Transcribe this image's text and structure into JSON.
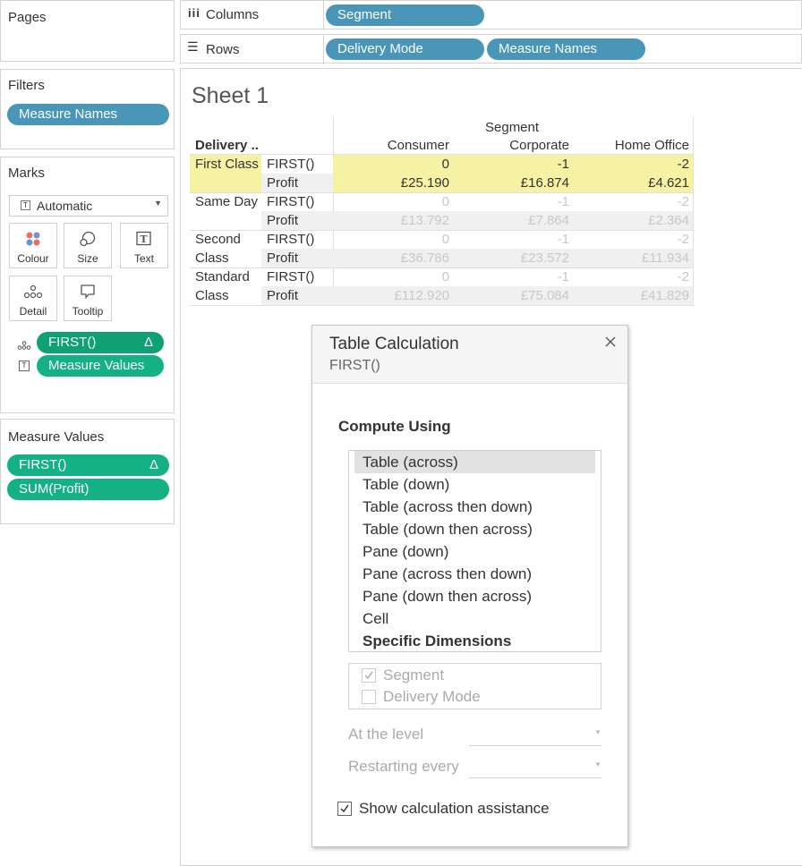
{
  "pages_panel": {
    "title": "Pages"
  },
  "columns_shelf": {
    "label": "Columns",
    "pills": [
      "Segment"
    ]
  },
  "rows_shelf": {
    "label": "Rows",
    "pills": [
      "Delivery Mode",
      "Measure Names"
    ]
  },
  "filters_panel": {
    "title": "Filters",
    "pills": [
      "Measure Names"
    ]
  },
  "marks_panel": {
    "title": "Marks",
    "mark_type": "Automatic",
    "buttons": [
      "Colour",
      "Size",
      "Text",
      "Detail",
      "Tooltip"
    ],
    "pills": [
      {
        "label": "FIRST()",
        "delta": "Δ",
        "icon": "detail-icon"
      },
      {
        "label": "Measure Values",
        "icon": "text-icon"
      }
    ]
  },
  "measure_values_panel": {
    "title": "Measure Values",
    "pills": [
      {
        "label": "FIRST()",
        "delta": "Δ"
      },
      {
        "label": "SUM(Profit)"
      }
    ]
  },
  "sheet": {
    "title": "Sheet 1",
    "column_header_group": "Segment",
    "row_header": "Delivery ..",
    "columns": [
      "Consumer",
      "Corporate",
      "Home Office"
    ],
    "rows": [
      {
        "mode_line1": "First Class",
        "mode_line2": "",
        "first_label": "FIRST()",
        "profit_label": "Profit",
        "first": [
          "0",
          "-1",
          "-2"
        ],
        "profit": [
          "£25.190",
          "£16.874",
          "£4.621"
        ]
      },
      {
        "mode_line1": "Same Day",
        "mode_line2": "",
        "first_label": "FIRST()",
        "profit_label": "Profit",
        "first": [
          "0",
          "-1",
          "-2"
        ],
        "profit": [
          "£13.792",
          "£7.864",
          "£2.364"
        ]
      },
      {
        "mode_line1": "Second",
        "mode_line2": "Class",
        "first_label": "FIRST()",
        "profit_label": "Profit",
        "first": [
          "0",
          "-1",
          "-2"
        ],
        "profit": [
          "£36.786",
          "£23.572",
          "£11.934"
        ]
      },
      {
        "mode_line1": "Standard",
        "mode_line2": "Class",
        "first_label": "FIRST()",
        "profit_label": "Profit",
        "first": [
          "0",
          "-1",
          "-2"
        ],
        "profit": [
          "£112.920",
          "£75.084",
          "£41.829"
        ]
      }
    ],
    "highlight_color": "#f5f2a3"
  },
  "dialog": {
    "title": "Table Calculation",
    "subtitle": "FIRST()",
    "section": "Compute Using",
    "options": [
      "Table (across)",
      "Table (down)",
      "Table (across then down)",
      "Table (down then across)",
      "Pane (down)",
      "Pane (across then down)",
      "Pane (down then across)",
      "Cell",
      "Specific Dimensions"
    ],
    "selected_option": "Table (across)",
    "dimensions": [
      {
        "label": "Segment",
        "checked": true
      },
      {
        "label": "Delivery Mode",
        "checked": false
      }
    ],
    "at_level_label": "At the level",
    "restarting_label": "Restarting every",
    "assist_label": "Show calculation assistance",
    "assist_checked": true
  }
}
